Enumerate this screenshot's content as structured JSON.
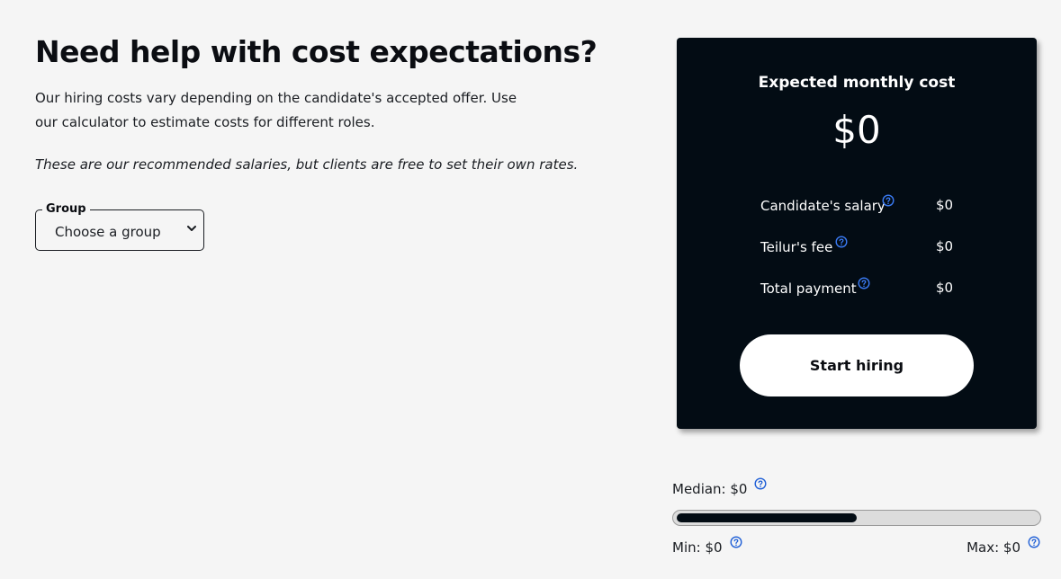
{
  "heading": "Need help with cost expectations?",
  "intro": "Our hiring costs vary depending on the candidate's accepted offer. Use our calculator to estimate costs for different roles.",
  "note": "These are our recommended salaries, but clients are free to set their own rates.",
  "group_select": {
    "label": "Group",
    "value": "Choose a group"
  },
  "summary": {
    "title": "Expected monthly cost",
    "amount": "$0",
    "rows": [
      {
        "label": "Candidate's salary",
        "value": "$0"
      },
      {
        "label": "Teilur's fee",
        "value": "$0"
      },
      {
        "label": "Total payment",
        "value": "$0"
      }
    ],
    "cta_label": "Start hiring"
  },
  "salary_range": {
    "median_label": "Median: $0",
    "min_label": "Min: $0",
    "max_label": "Max: $0",
    "median_fraction": 0.5
  },
  "colors": {
    "background": "#f5f5f5",
    "card": "#030c14",
    "help_icon_on_light": "#1f5fd6",
    "help_icon_on_dark": "#3a7bf5"
  },
  "icons": {
    "help": "question-circle-icon",
    "dropdown": "chevron-down-icon"
  }
}
